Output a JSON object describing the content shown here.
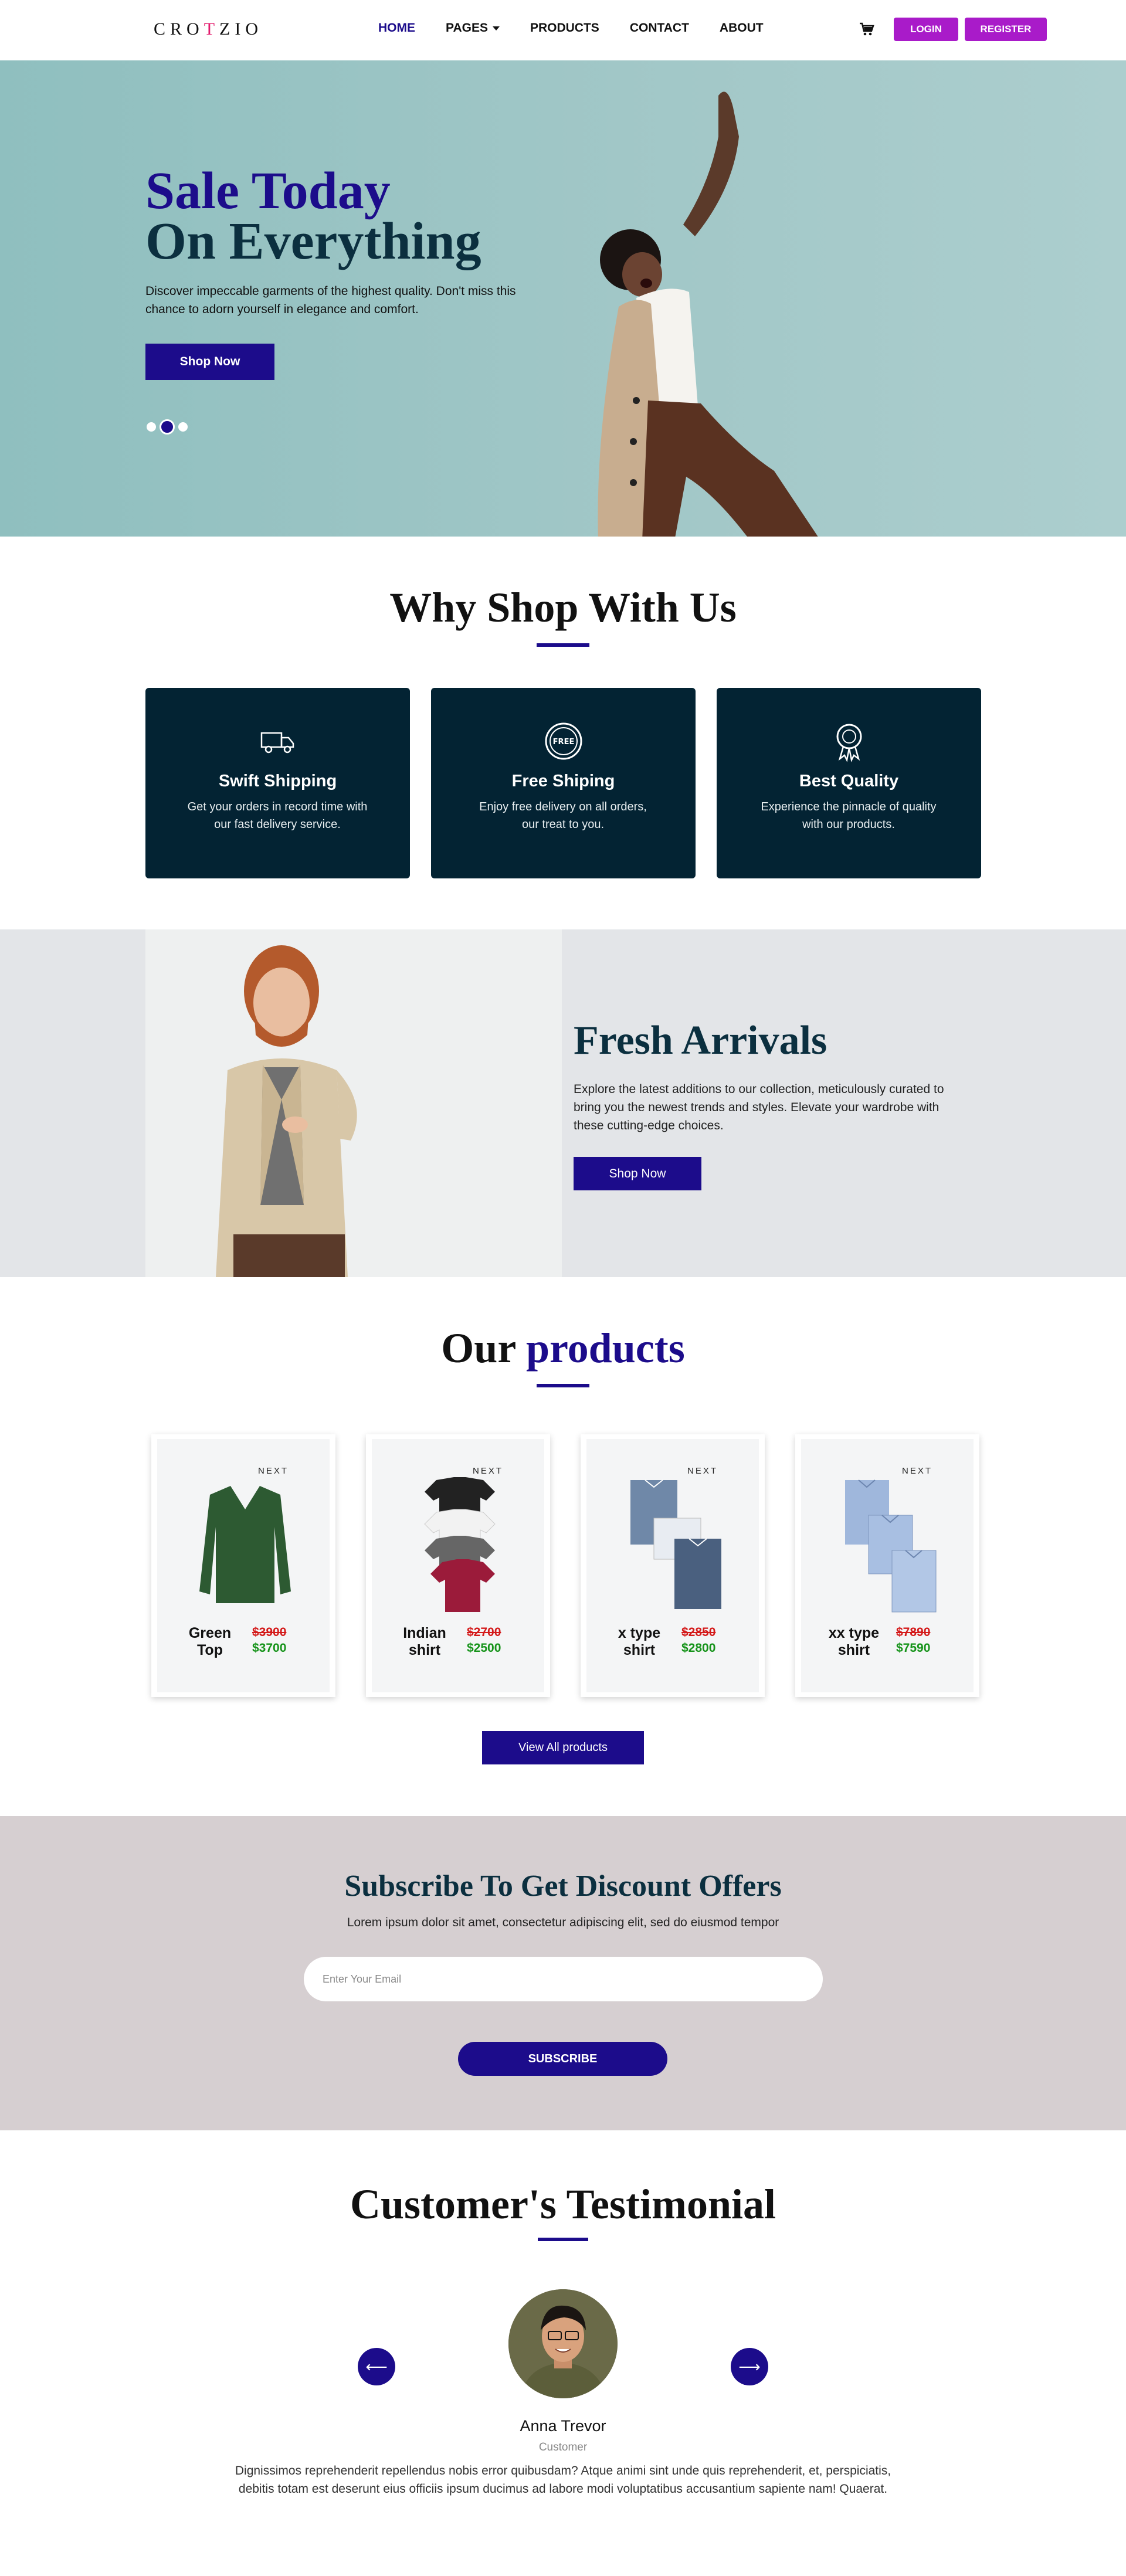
{
  "brand": {
    "name_pre": "CRO",
    "name_accent": "T",
    "name_post": "ZIO"
  },
  "nav": {
    "items": [
      {
        "label": "HOME",
        "active": true
      },
      {
        "label": "PAGES",
        "dropdown": true
      },
      {
        "label": "PRODUCTS"
      },
      {
        "label": "CONTACT"
      },
      {
        "label": "ABOUT"
      }
    ],
    "cart_icon": "cart-icon",
    "login_label": "LOGIN",
    "register_label": "REGISTER"
  },
  "hero": {
    "title_line1": "Sale Today",
    "title_line2": "On Everything",
    "description": "Discover impeccable garments of the highest quality. Don't miss this chance to adorn yourself in elegance and comfort.",
    "button_label": "Shop Now",
    "slides": 3,
    "active_slide": 2
  },
  "why": {
    "title": "Why Shop With Us",
    "features": [
      {
        "icon": "truck-icon",
        "title": "Swift Shipping",
        "text": "Get your orders in record time with our fast delivery service."
      },
      {
        "icon": "free-badge-icon",
        "title": "Free Shiping",
        "text": "Enjoy free delivery on all orders, our treat to you."
      },
      {
        "icon": "award-ribbon-icon",
        "title": "Best Quality",
        "text": "Experience the pinnacle of quality with our products."
      }
    ]
  },
  "fresh": {
    "title": "Fresh Arrivals",
    "description": "Explore the latest additions to our collection, meticulously curated to bring you the newest trends and styles. Elevate your wardrobe with these cutting-edge choices.",
    "button_label": "Shop Now"
  },
  "products": {
    "title_pre": "Our ",
    "title_hl": "products",
    "items": [
      {
        "name": "Green Top",
        "old_price": "$3900",
        "new_price": "$3700",
        "brand_tag": "NEXT"
      },
      {
        "name": "Indian shirt",
        "old_price": "$2700",
        "new_price": "$2500",
        "brand_tag": "NEXT"
      },
      {
        "name": "x type shirt",
        "old_price": "$2850",
        "new_price": "$2800",
        "brand_tag": "NEXT"
      },
      {
        "name": "xx type shirt",
        "old_price": "$7890",
        "new_price": "$7590",
        "brand_tag": "NEXT"
      }
    ],
    "view_all_label": "View All products"
  },
  "subscribe": {
    "title": "Subscribe To Get Discount Offers",
    "description": "Lorem ipsum dolor sit amet, consectetur adipiscing elit, sed do eiusmod tempor",
    "input_placeholder": "Enter Your Email",
    "button_label": "SUBSCRIBE"
  },
  "testimonial": {
    "title": "Customer's Testimonial",
    "prev_icon": "arrow-left-icon",
    "next_icon": "arrow-right-icon",
    "name": "Anna Trevor",
    "role": "Customer",
    "text": "Dignissimos reprehenderit repellendus nobis error quibusdam? Atque animi sint unde quis reprehenderit, et, perspiciatis, debitis totam est deserunt eius officiis ipsum ducimus ad labore modi voluptatibus accusantium sapiente nam! Quaerat."
  },
  "colors": {
    "primary": "#1c0c8b",
    "dark_teal": "#0b2f3f",
    "feature_bg": "#032333",
    "auth_button": "#a91bc9",
    "old_price": "#d41a1a",
    "new_price": "#16931a",
    "subscribe_bg": "#d6cfd1"
  }
}
